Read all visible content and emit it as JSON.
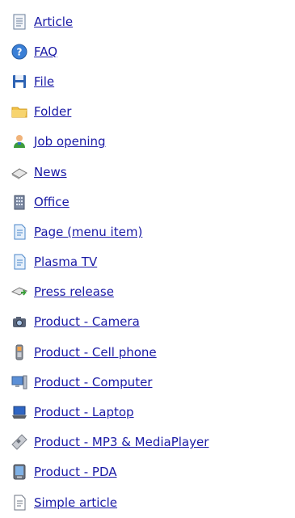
{
  "items": [
    {
      "label": "Article",
      "icon": "document-icon"
    },
    {
      "label": "FAQ",
      "icon": "help-icon"
    },
    {
      "label": "File",
      "icon": "floppy-disk-icon"
    },
    {
      "label": "Folder",
      "icon": "folder-icon"
    },
    {
      "label": "Job opening",
      "icon": "person-icon"
    },
    {
      "label": "News",
      "icon": "news-icon"
    },
    {
      "label": "Office",
      "icon": "office-building-icon"
    },
    {
      "label": "Page (menu item)",
      "icon": "page-icon"
    },
    {
      "label": "Plasma TV",
      "icon": "page-icon"
    },
    {
      "label": "Press release",
      "icon": "press-release-icon"
    },
    {
      "label": "Product - Camera",
      "icon": "camera-icon"
    },
    {
      "label": "Product - Cell phone",
      "icon": "cell-phone-icon"
    },
    {
      "label": "Product - Computer",
      "icon": "computer-icon"
    },
    {
      "label": "Product - Laptop",
      "icon": "laptop-icon"
    },
    {
      "label": "Product - MP3 & MediaPlayer",
      "icon": "mp3-player-icon"
    },
    {
      "label": "Product - PDA",
      "icon": "pda-icon"
    },
    {
      "label": "Simple article",
      "icon": "simple-document-icon"
    }
  ],
  "colors": {
    "link": "#1a1aa6"
  }
}
